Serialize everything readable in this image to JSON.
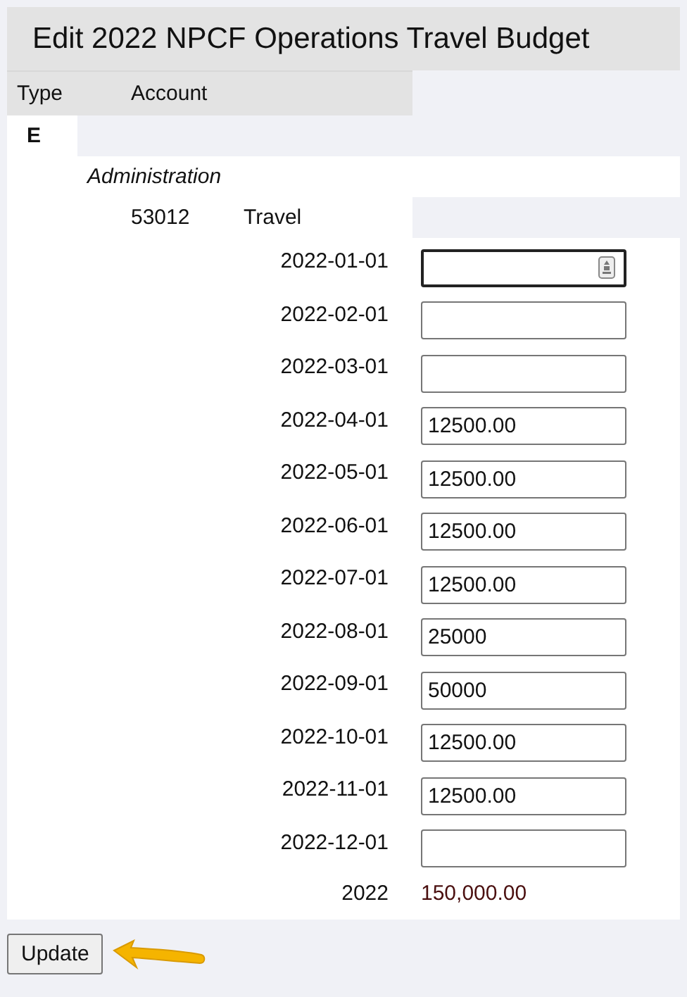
{
  "title": "Edit 2022 NPCF Operations Travel Budget",
  "columns": [
    "Type",
    "Account"
  ],
  "type": "E",
  "group": "Administration",
  "account": {
    "number": "53012",
    "name": "Travel"
  },
  "months": [
    {
      "date": "2022-01-01",
      "focused": true
    },
    {
      "date": "2022-02-01",
      "focused": false
    },
    {
      "date": "2022-03-01",
      "focused": false
    },
    {
      "date": "2022-04-01",
      "value": "12500.00",
      "focused": false
    },
    {
      "date": "2022-05-01",
      "value": "12500.00",
      "focused": false
    },
    {
      "date": "2022-06-01",
      "value": "12500.00",
      "focused": false
    },
    {
      "date": "2022-07-01",
      "value": "12500.00",
      "focused": false
    },
    {
      "date": "2022-08-01",
      "value": "25000",
      "focused": false
    },
    {
      "date": "2022-09-01",
      "value": "50000",
      "focused": false
    },
    {
      "date": "2022-10-01",
      "value": "12500.00",
      "focused": false
    },
    {
      "date": "2022-11-01",
      "value": "12500.00",
      "focused": false
    },
    {
      "date": "2022-12-01",
      "focused": false
    }
  ],
  "total": {
    "label": "2022",
    "amount": "150,000.00"
  },
  "button": "Update"
}
